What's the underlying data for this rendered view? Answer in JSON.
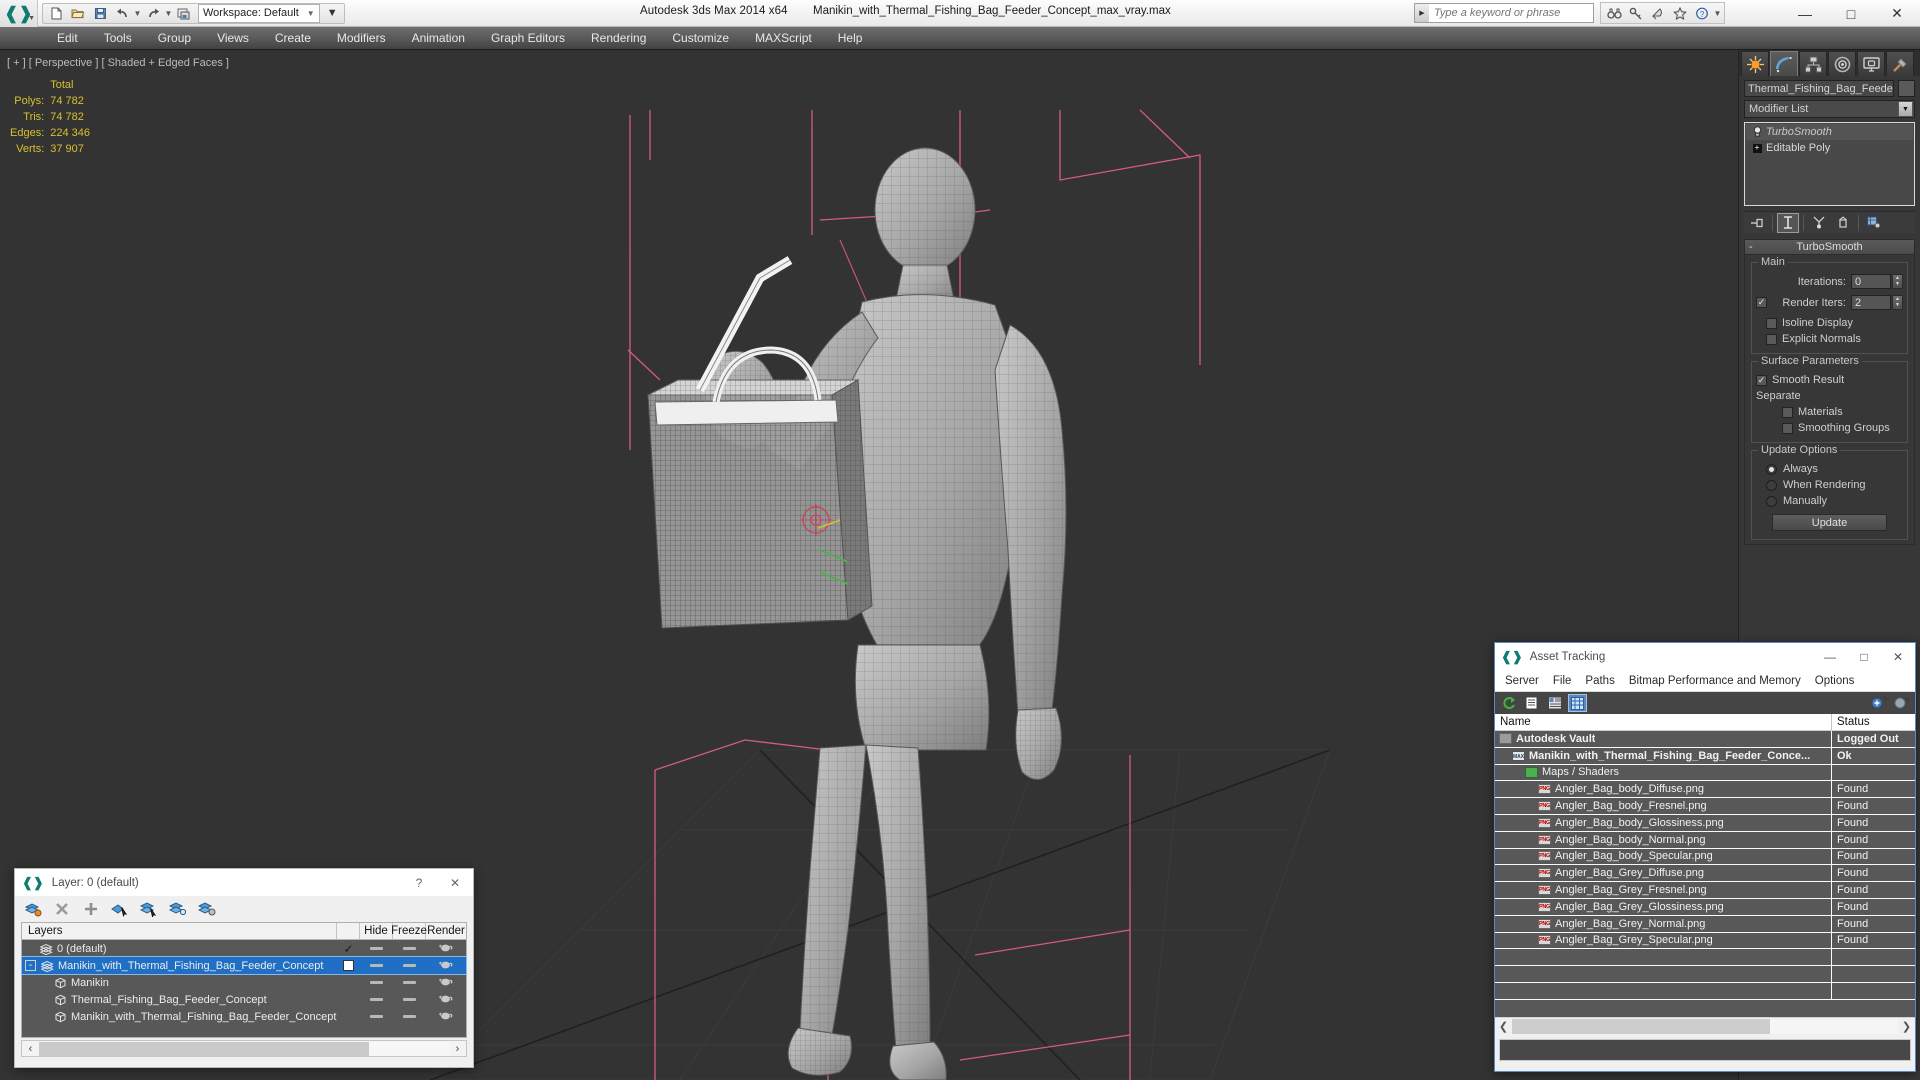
{
  "titlebar": {
    "app_title": "Autodesk 3ds Max  2014 x64",
    "file_title": "Manikin_with_Thermal_Fishing_Bag_Feeder_Concept_max_vray.max",
    "workspace_label": "Workspace: Default",
    "search_placeholder": "Type a keyword or phrase",
    "quick_access": [
      {
        "name": "new-file-icon",
        "glyph": "□"
      },
      {
        "name": "open-file-icon",
        "glyph": "▱"
      },
      {
        "name": "save-file-icon",
        "glyph": "▣"
      },
      {
        "name": "undo-icon",
        "glyph": "↶"
      },
      {
        "name": "redo-icon",
        "glyph": "↷"
      },
      {
        "name": "set-project-folder-icon",
        "glyph": "⧉"
      }
    ],
    "help_icons": [
      {
        "name": "binoculars-icon",
        "glyph": "༼༽"
      },
      {
        "name": "key-icon",
        "glyph": "⚷"
      },
      {
        "name": "satellite-dish-icon",
        "glyph": "◠"
      },
      {
        "name": "favorites-star-icon",
        "glyph": "☆"
      },
      {
        "name": "help-question-icon",
        "glyph": "?"
      }
    ],
    "window_buttons": [
      {
        "name": "minimize-button",
        "glyph": "—"
      },
      {
        "name": "maximize-button",
        "glyph": "□"
      },
      {
        "name": "close-button",
        "glyph": "✕"
      }
    ]
  },
  "menubar": {
    "items": [
      "Edit",
      "Tools",
      "Group",
      "Views",
      "Create",
      "Modifiers",
      "Animation",
      "Graph Editors",
      "Rendering",
      "Customize",
      "MAXScript",
      "Help"
    ]
  },
  "viewport": {
    "label": "[ + ] [ Perspective ] [ Shaded + Edged Faces ]",
    "stats_header": "Total",
    "stats": [
      {
        "label": "Polys:",
        "value": "74 782"
      },
      {
        "label": "Tris:",
        "value": "74 782"
      },
      {
        "label": "Edges:",
        "value": "224 346"
      },
      {
        "label": "Verts:",
        "value": "37 907"
      }
    ],
    "stats_color": "#d8c02e",
    "background_color": "#333333",
    "helper_line_color": "#e05a8f"
  },
  "command_panel": {
    "tabs": [
      {
        "name": "create-tab",
        "icon": "star-burst-icon",
        "active": false
      },
      {
        "name": "modify-tab",
        "icon": "bent-arc-icon",
        "active": true
      },
      {
        "name": "hierarchy-tab",
        "icon": "hierarchy-nodes-icon",
        "active": false
      },
      {
        "name": "motion-tab",
        "icon": "motion-wheel-icon",
        "active": false
      },
      {
        "name": "display-tab",
        "icon": "monitor-icon",
        "active": false
      },
      {
        "name": "utilities-tab",
        "icon": "hammer-icon",
        "active": false
      }
    ],
    "object_name": "Thermal_Fishing_Bag_Feeder",
    "modifier_list_label": "Modifier List",
    "stack": [
      {
        "name": "TurboSmooth",
        "selected": true,
        "icon": "lightbulb-icon"
      },
      {
        "name": "Editable Poly",
        "selected": false,
        "icon": "plus-box-icon"
      }
    ],
    "stack_tools": [
      {
        "name": "pin-stack-button",
        "glyph": "⊣■"
      },
      {
        "name": "show-end-result-button",
        "glyph": "I"
      },
      {
        "name": "make-unique-button",
        "glyph": "⑂"
      },
      {
        "name": "remove-modifier-button",
        "glyph": "☂"
      },
      {
        "name": "configure-modifier-sets-button",
        "glyph": "▦"
      }
    ],
    "rollout": {
      "title": "TurboSmooth",
      "main_group": "Main",
      "iterations_label": "Iterations:",
      "iterations_value": "0",
      "render_iters_label": "Render Iters:",
      "render_iters_value": "2",
      "render_iters_checked": true,
      "isoline_display_label": "Isoline Display",
      "isoline_display_checked": false,
      "explicit_normals_label": "Explicit Normals",
      "explicit_normals_checked": false,
      "surface_group": "Surface Parameters",
      "smooth_result_label": "Smooth Result",
      "smooth_result_checked": true,
      "separate_label": "Separate",
      "materials_label": "Materials",
      "materials_checked": false,
      "smoothing_groups_label": "Smoothing Groups",
      "smoothing_groups_checked": false,
      "update_group": "Update Options",
      "update_options": [
        {
          "label": "Always",
          "selected": true
        },
        {
          "label": "When Rendering",
          "selected": false
        },
        {
          "label": "Manually",
          "selected": false
        }
      ],
      "update_button": "Update"
    }
  },
  "asset_tracking": {
    "title": "Asset Tracking",
    "menu": [
      "Server",
      "File",
      "Paths",
      "Bitmap Performance and Memory",
      "Options"
    ],
    "toolbar": [
      {
        "name": "refresh-icon",
        "glyph": "↻",
        "selected": false
      },
      {
        "name": "list-view-icon",
        "glyph": "☰",
        "selected": false
      },
      {
        "name": "details-view-icon",
        "glyph": "▤",
        "selected": false
      },
      {
        "name": "grid-view-icon",
        "glyph": "▦",
        "selected": true
      },
      {
        "name": "add-help-icon",
        "glyph": "?",
        "selected": false
      },
      {
        "name": "help-icon",
        "glyph": "?",
        "selected": false
      }
    ],
    "columns": [
      "Name",
      "Status"
    ],
    "rows": [
      {
        "name": "Autodesk Vault",
        "status": "Logged Out",
        "indent": 0,
        "icon": "vault-icon",
        "bold": true
      },
      {
        "name": "Manikin_with_Thermal_Fishing_Bag_Feeder_Conce...",
        "status": "Ok",
        "indent": 1,
        "icon": "max-file-icon",
        "bold": true
      },
      {
        "name": "Maps / Shaders",
        "status": "",
        "indent": 2,
        "icon": "maps-shaders-icon",
        "bold": false
      },
      {
        "name": "Angler_Bag_body_Diffuse.png",
        "status": "Found",
        "indent": 3,
        "icon": "png-icon",
        "bold": false
      },
      {
        "name": "Angler_Bag_body_Fresnel.png",
        "status": "Found",
        "indent": 3,
        "icon": "png-icon",
        "bold": false
      },
      {
        "name": "Angler_Bag_body_Glossiness.png",
        "status": "Found",
        "indent": 3,
        "icon": "png-icon",
        "bold": false
      },
      {
        "name": "Angler_Bag_body_Normal.png",
        "status": "Found",
        "indent": 3,
        "icon": "png-icon",
        "bold": false
      },
      {
        "name": "Angler_Bag_body_Specular.png",
        "status": "Found",
        "indent": 3,
        "icon": "png-icon",
        "bold": false
      },
      {
        "name": "Angler_Bag_Grey_Diffuse.png",
        "status": "Found",
        "indent": 3,
        "icon": "png-icon",
        "bold": false
      },
      {
        "name": "Angler_Bag_Grey_Fresnel.png",
        "status": "Found",
        "indent": 3,
        "icon": "png-icon",
        "bold": false
      },
      {
        "name": "Angler_Bag_Grey_Glossiness.png",
        "status": "Found",
        "indent": 3,
        "icon": "png-icon",
        "bold": false
      },
      {
        "name": "Angler_Bag_Grey_Normal.png",
        "status": "Found",
        "indent": 3,
        "icon": "png-icon",
        "bold": false
      },
      {
        "name": "Angler_Bag_Grey_Specular.png",
        "status": "Found",
        "indent": 3,
        "icon": "png-icon",
        "bold": false
      },
      {
        "name": "",
        "status": "",
        "indent": 0,
        "icon": "",
        "bold": false
      },
      {
        "name": "",
        "status": "",
        "indent": 0,
        "icon": "",
        "bold": false
      },
      {
        "name": "",
        "status": "",
        "indent": 0,
        "icon": "",
        "bold": false
      }
    ],
    "window_buttons": [
      {
        "name": "minimize-button",
        "glyph": "—"
      },
      {
        "name": "maximize-button",
        "glyph": "□"
      },
      {
        "name": "close-button",
        "glyph": "✕"
      }
    ]
  },
  "layer_dialog": {
    "title": "Layer: 0 (default)",
    "help_glyph": "?",
    "close_glyph": "✕",
    "toolbar": [
      {
        "name": "create-new-layer-icon",
        "glyph": "≡"
      },
      {
        "name": "delete-layer-icon",
        "glyph": "✕"
      },
      {
        "name": "add-selection-to-layer-icon",
        "glyph": "＋"
      },
      {
        "name": "select-objects-in-layer-icon",
        "glyph": "◪"
      },
      {
        "name": "set-current-layer-icon",
        "glyph": "≣"
      },
      {
        "name": "highlight-selected-objects-icon",
        "glyph": "≣"
      },
      {
        "name": "layer-properties-icon",
        "glyph": "≣"
      }
    ],
    "columns": [
      "Layers",
      "Hide",
      "Freeze",
      "Render"
    ],
    "rows": [
      {
        "name": "0 (default)",
        "indent": 1,
        "current": true,
        "selected": false,
        "expander": "",
        "icon": "layer-icon"
      },
      {
        "name": "Manikin_with_Thermal_Fishing_Bag_Feeder_Concept",
        "indent": 0,
        "current": false,
        "selected": true,
        "expander": "-",
        "icon": "layer-icon"
      },
      {
        "name": "Manikin",
        "indent": 2,
        "current": false,
        "selected": false,
        "expander": "",
        "icon": "object-box-icon"
      },
      {
        "name": "Thermal_Fishing_Bag_Feeder_Concept",
        "indent": 2,
        "current": false,
        "selected": false,
        "expander": "",
        "icon": "object-box-icon"
      },
      {
        "name": "Manikin_with_Thermal_Fishing_Bag_Feeder_Concept",
        "indent": 2,
        "current": false,
        "selected": false,
        "expander": "",
        "icon": "object-box-icon"
      }
    ],
    "scroll_left_glyph": "‹",
    "scroll_right_glyph": "›"
  }
}
